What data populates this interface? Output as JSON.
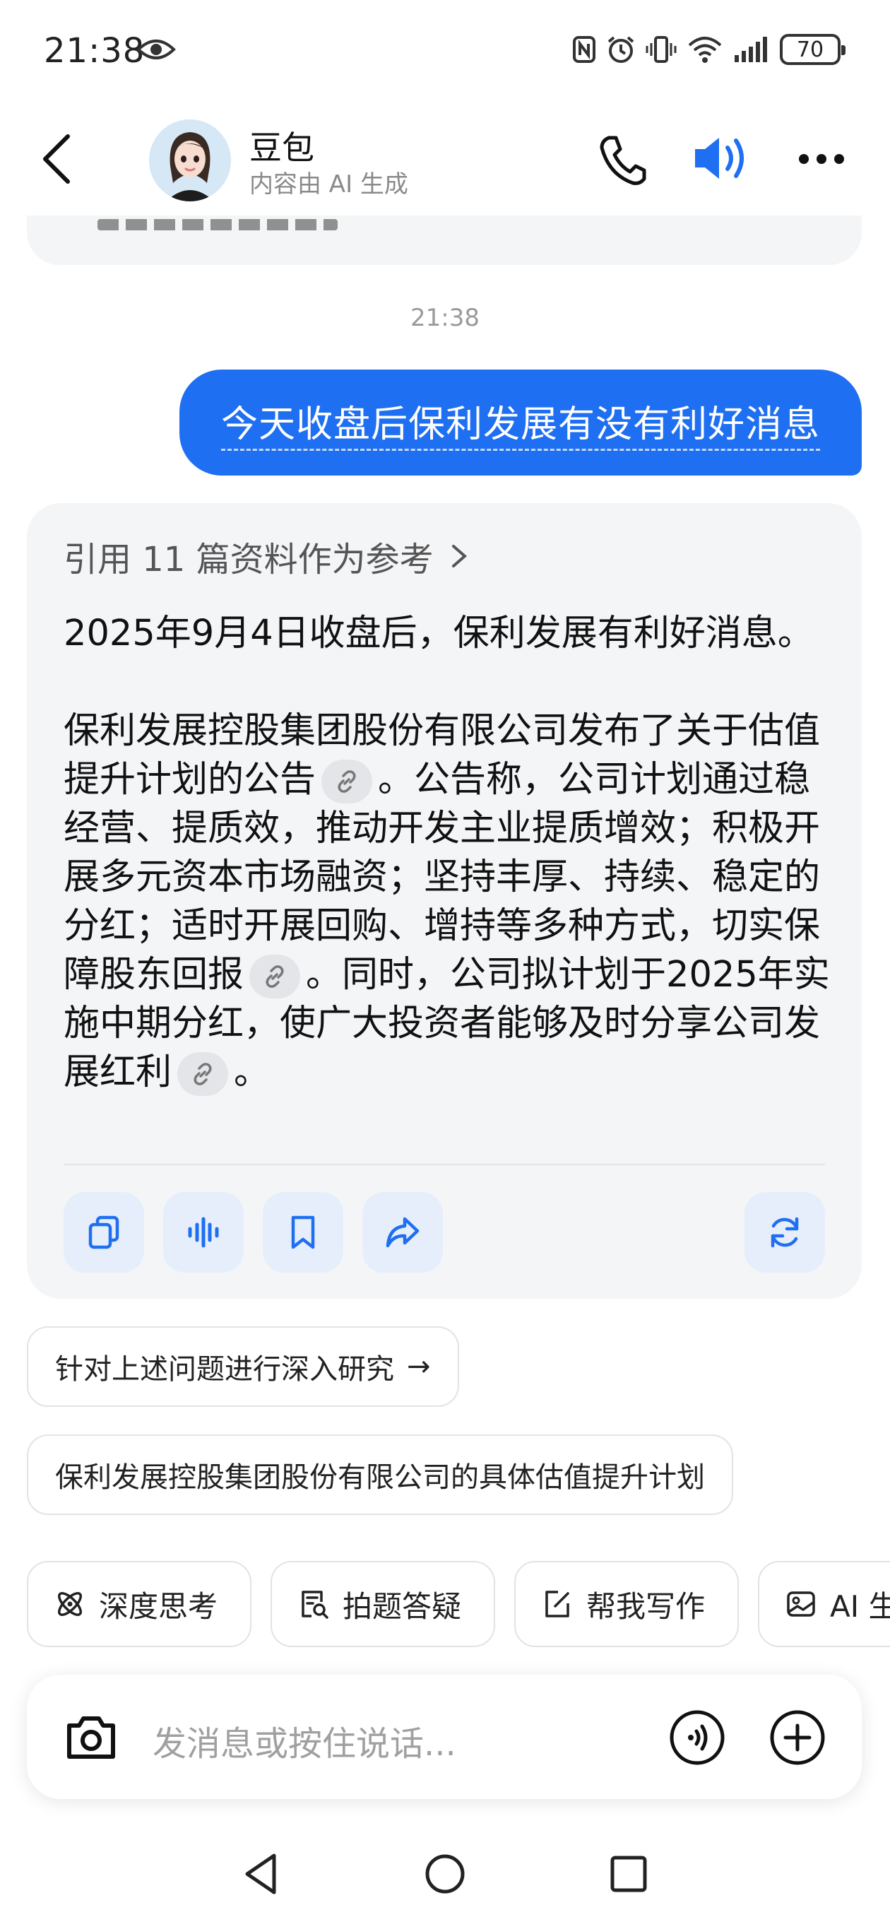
{
  "status_bar": {
    "time": "21:38",
    "battery": "70"
  },
  "header": {
    "title": "豆包",
    "subtitle": "内容由 AI 生成"
  },
  "chat": {
    "timestamp": "21:38",
    "user_message": "今天收盘后保利发展有没有利好消息",
    "ai_reply": {
      "references": "引用 11 篇资料作为参考",
      "paragraph_1": "2025年9月4日收盘后，保利发展有利好消息。",
      "paragraph_2_part_1": "保利发展控股集团股份有限公司发布了关于估值提升计划的公告",
      "paragraph_2_part_2": "。公告称，公司计划通过稳经营、提质效，推动开发主业提质增效；积极开展多元资本市场融资；坚持丰厚、持续、稳定的分红；适时开展回购、增持等多种方式，切实保障股东回报",
      "paragraph_2_part_3": "。同时，公司拟计划于2025年实施中期分红，使广大投资者能够及时分享公司发展红利",
      "paragraph_2_part_4": "。"
    }
  },
  "suggestions": [
    {
      "label": "针对上述问题进行深入研究",
      "arrow": "→"
    },
    {
      "label": "保利发展控股集团股份有限公司的具体估值提升计划"
    }
  ],
  "skills": [
    {
      "label": "深度思考",
      "icon": "atom-icon"
    },
    {
      "label": "拍题答疑",
      "icon": "scan-question-icon"
    },
    {
      "label": "帮我写作",
      "icon": "edit-icon"
    },
    {
      "label": "AI 生图",
      "icon": "image-icon"
    }
  ],
  "input": {
    "placeholder": "发消息或按住说话..."
  },
  "colors": {
    "accent": "#1f6ff2",
    "card_bg": "#f4f5f7",
    "action_bg": "#e7eefb"
  }
}
